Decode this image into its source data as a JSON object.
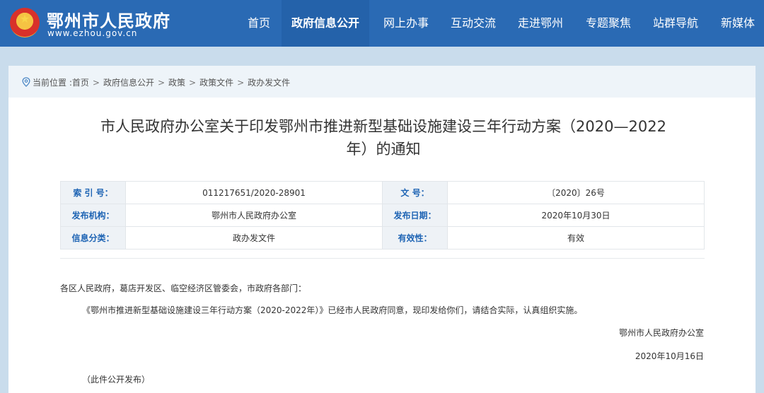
{
  "header": {
    "site_name": "鄂州市人民政府",
    "site_url": "www.ezhou.gov.cn",
    "nav": [
      {
        "label": "首页"
      },
      {
        "label": "政府信息公开"
      },
      {
        "label": "网上办事"
      },
      {
        "label": "互动交流"
      },
      {
        "label": "走进鄂州"
      },
      {
        "label": "专题聚焦"
      },
      {
        "label": "站群导航"
      },
      {
        "label": "新媒体"
      }
    ],
    "active_nav": "政府信息公开"
  },
  "breadcrumb": {
    "prefix": "当前位置 :",
    "items": [
      "首页",
      "政府信息公开",
      "政策",
      "政策文件",
      "政办发文件"
    ],
    "separator": ">"
  },
  "article": {
    "title_line1": "市人民政府办公室关于印发鄂州市推进新型基础设施建设三年行动方案（2020—2022",
    "title_line2": "年）的通知",
    "meta": {
      "index_label": "索 引 号：",
      "index_value": "011217651/2020-28901",
      "doc_no_label": "文    号：",
      "doc_no_value": "〔2020〕26号",
      "issuer_label": "发布机构：",
      "issuer_value": "鄂州市人民政府办公室",
      "date_label": "发布日期：",
      "date_value": "2020年10月30日",
      "category_label": "信息分类：",
      "category_value": "政办发文件",
      "validity_label": "有效性：",
      "validity_value": "有效"
    },
    "salutation": "各区人民政府，葛店开发区、临空经济区管委会，市政府各部门：",
    "paragraph": "《鄂州市推进新型基础设施建设三年行动方案（2020-2022年）》已经市人民政府同意，现印发给你们，请结合实际，认真组织实施。",
    "signature": "鄂州市人民政府办公室",
    "sign_date": "2020年10月16日",
    "note": "（此件公开发布）"
  },
  "colors": {
    "header_bg": "#2a6ab4",
    "page_bg": "#c9dcec",
    "label_blue": "#1e64b4"
  },
  "icons": {
    "emblem": "national-emblem-icon",
    "location": "location-pin-icon"
  }
}
